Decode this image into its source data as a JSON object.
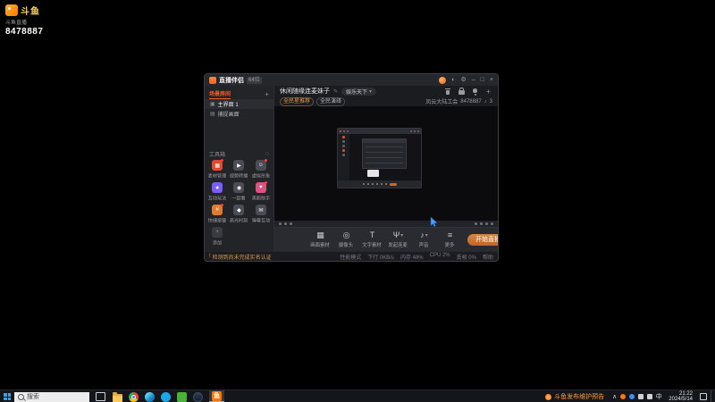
{
  "watermark": {
    "logo_text": "斗鱼",
    "sub_text": "斗鱼直播",
    "room_id": "8478887"
  },
  "app": {
    "titlebar": {
      "title": "直播伴侣",
      "badge": "64位"
    },
    "sidebar": {
      "tab": "场景房间",
      "scenes": [
        {
          "label": "主界面 1"
        },
        {
          "label": "捕捉画面"
        }
      ],
      "toolbox_label": "工具箱",
      "tools": [
        {
          "label": "素材管理"
        },
        {
          "label": "视频转播"
        },
        {
          "label": "虚拟形象"
        },
        {
          "label": "互动玩法"
        },
        {
          "label": "一起看"
        },
        {
          "label": "美颜助手"
        },
        {
          "label": "快捷按键"
        },
        {
          "label": "高光时刻"
        },
        {
          "label": "弹幕互动"
        }
      ],
      "add_label": "添加"
    },
    "header": {
      "stream_title": "休闲随缘连麦妹子",
      "category": "娱乐天下",
      "tags": [
        {
          "label": "全民星推荐"
        },
        {
          "label": "全民演绎"
        }
      ],
      "room_label": "凤云大陆工会",
      "room_id": "8478887",
      "viewer_count": "3"
    },
    "toolbar": {
      "items": [
        {
          "label": "画面素材"
        },
        {
          "label": "摄像头"
        },
        {
          "label": "文字素材"
        },
        {
          "label": "发起连麦"
        },
        {
          "label": "声音"
        },
        {
          "label": "更多"
        }
      ],
      "start_button": "开始直播"
    },
    "footer": {
      "warning": "检测到尚未完成实名认证",
      "items": [
        {
          "label": "性能模式"
        },
        {
          "label": "下行 0KB/s"
        },
        {
          "label": "内存 48%"
        },
        {
          "label": "CPU 2%"
        },
        {
          "label": "丢帧 0%"
        },
        {
          "label": "帮助"
        }
      ]
    }
  },
  "taskbar": {
    "search_placeholder": "搜索",
    "news_text": "斗鱼发布维护预告",
    "lang": "中",
    "time": "21:22",
    "date": "2024/5/14"
  },
  "colors": {
    "accent": "#ff5d23",
    "douyu_orange": "#ff7700"
  }
}
